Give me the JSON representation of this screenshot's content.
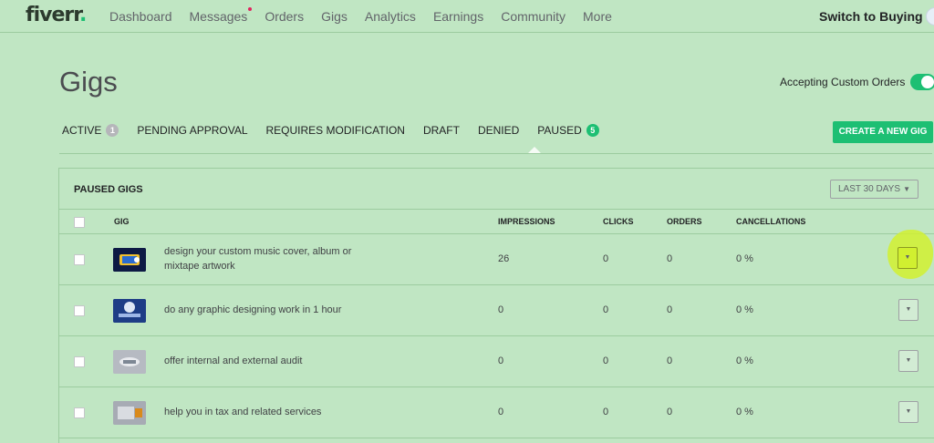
{
  "nav": {
    "logo": "fiverr",
    "items": [
      "Dashboard",
      "Messages",
      "Orders",
      "Gigs",
      "Analytics",
      "Earnings",
      "Community",
      "More"
    ],
    "switch_label": "Switch to Buying"
  },
  "page": {
    "title": "Gigs",
    "custom_orders_label": "Accepting Custom Orders",
    "custom_orders_on": true
  },
  "tabs": [
    {
      "label": "ACTIVE",
      "count": "1"
    },
    {
      "label": "PENDING APPROVAL",
      "count": ""
    },
    {
      "label": "REQUIRES MODIFICATION",
      "count": ""
    },
    {
      "label": "DRAFT",
      "count": ""
    },
    {
      "label": "DENIED",
      "count": ""
    },
    {
      "label": "PAUSED",
      "count": "5"
    }
  ],
  "create_button": "CREATE A NEW GIG",
  "panel": {
    "title": "PAUSED GIGS",
    "range": "LAST 30 DAYS",
    "columns": [
      "GIG",
      "IMPRESSIONS",
      "CLICKS",
      "ORDERS",
      "CANCELLATIONS"
    ]
  },
  "gigs": [
    {
      "title": "design your custom music cover, album or mixtape artwork",
      "impressions": "26",
      "clicks": "0",
      "orders": "0",
      "cancellations": "0 %"
    },
    {
      "title": "do any graphic designing work in 1 hour",
      "impressions": "0",
      "clicks": "0",
      "orders": "0",
      "cancellations": "0 %"
    },
    {
      "title": "offer internal and external audit",
      "impressions": "0",
      "clicks": "0",
      "orders": "0",
      "cancellations": "0 %"
    },
    {
      "title": "help you in tax and related services",
      "impressions": "0",
      "clicks": "0",
      "orders": "0",
      "cancellations": "0 %"
    }
  ],
  "colors": {
    "accent": "#1dbf73",
    "background": "#c0e6c3",
    "highlight": "#d1f030"
  }
}
